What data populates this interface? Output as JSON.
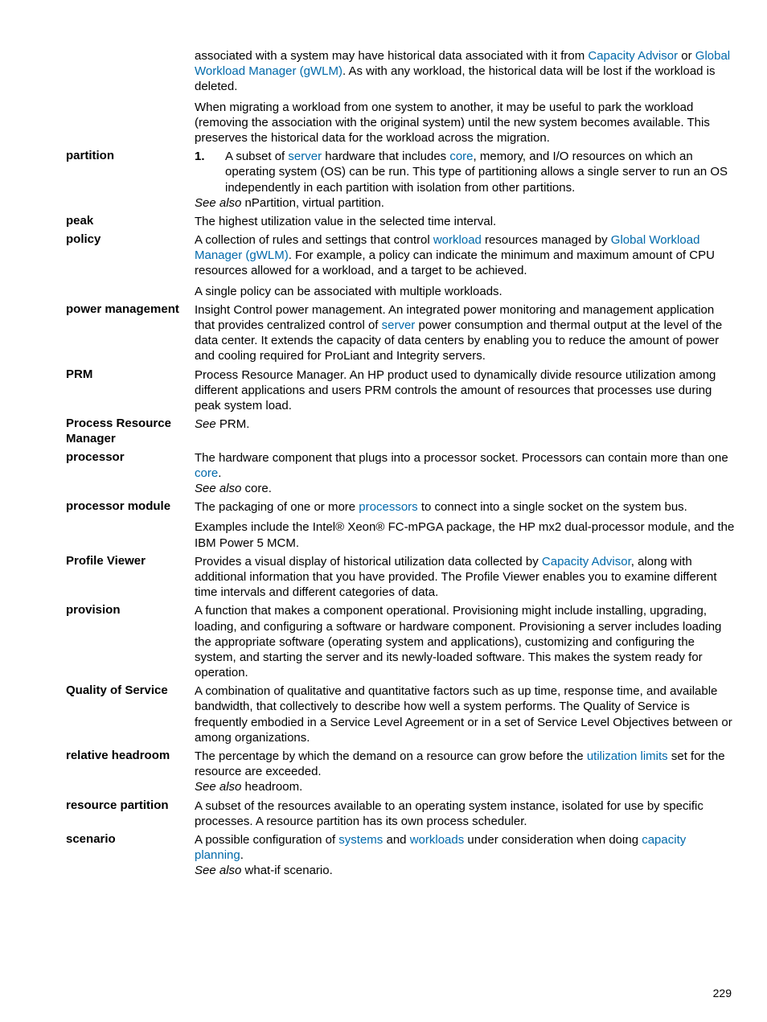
{
  "intro": {
    "p1_a": "associated with a system may have historical data associated with it from ",
    "p1_link1": "Capacity Advisor",
    "p1_b": " or ",
    "p1_link2": "Global Workload Manager (gWLM)",
    "p1_c": ". As with any workload, the historical data will be lost if the workload is deleted.",
    "p2": "When migrating a workload from one system to another, it may be useful to park the workload (removing the association with the original system) until the new system becomes available. This preserves the historical data for the workload across the migration."
  },
  "partition": {
    "term": "partition",
    "num": "1.",
    "d1_a": "A subset of ",
    "d1_link1": "server",
    "d1_b": " hardware that includes ",
    "d1_link2": "core",
    "d1_c": ", memory, and I/O resources on which an operating system (OS) can be run. This type of partitioning allows a single server to run an OS independently in each partition with isolation from other partitions.",
    "see": "See also",
    "see_text": " nPartition, virtual partition."
  },
  "peak": {
    "term": "peak",
    "d": "The highest utilization value in the selected time interval."
  },
  "policy": {
    "term": "policy",
    "d1_a": "A collection of rules and settings that control ",
    "d1_link1": "workload",
    "d1_b": " resources managed by ",
    "d1_link2": "Global Workload Manager (gWLM)",
    "d1_c": ". For example, a policy can indicate the minimum and maximum amount of CPU resources allowed for a workload, and a target to be achieved.",
    "d2": "A single policy can be associated with multiple workloads."
  },
  "power": {
    "term": "power management",
    "d_a": "Insight Control power management. An integrated power monitoring and management application that provides centralized control of ",
    "d_link": "server",
    "d_b": " power consumption and thermal output at the level of the data center. It extends the capacity of data centers by enabling you to reduce the amount of power and cooling required for ProLiant and Integrity servers."
  },
  "prm": {
    "term": "PRM",
    "d": "Process Resource Manager. An HP product used to dynamically divide resource utilization among different applications and users PRM controls the amount of resources that processes use during peak system load."
  },
  "prmfull": {
    "term": "Process Resource Manager",
    "see": "See",
    "see_text": " PRM."
  },
  "processor": {
    "term": "processor",
    "d_a": "The hardware component that plugs into a processor socket. Processors can contain more than one ",
    "d_link": "core",
    "d_b": ".",
    "see": "See also",
    "see_text": " core."
  },
  "procmod": {
    "term": "processor module",
    "d1_a": "The packaging of one or more ",
    "d1_link": "processors",
    "d1_b": " to connect into a single socket on the system bus.",
    "d2": "Examples include the Intel® Xeon® FC-mPGA package, the HP mx2 dual-processor module, and the IBM Power 5 MCM."
  },
  "profile": {
    "term": "Profile Viewer",
    "d_a": "Provides a visual display of historical utilization data collected by ",
    "d_link": "Capacity Advisor",
    "d_b": ", along with additional information that you have provided. The Profile Viewer enables you to examine different time intervals and different categories of data."
  },
  "provision": {
    "term": "provision",
    "d": "A function that makes a component operational. Provisioning might include installing, upgrading, loading, and configuring a software or hardware component. Provisioning a server includes loading the appropriate software (operating system and applications), customizing and configuring the system, and starting the server and its newly-loaded software. This makes the system ready for operation."
  },
  "qos": {
    "term": "Quality of Service",
    "d": "A combination of qualitative and quantitative factors such as up time, response time, and available bandwidth, that collectively to describe how well a system performs. The Quality of Service is frequently embodied in a Service Level Agreement or in a set of Service Level Objectives between or among organizations."
  },
  "relhead": {
    "term": "relative headroom",
    "d_a": "The percentage by which the demand on a resource can grow before the ",
    "d_link": "utilization limits",
    "d_b": " set for the resource are exceeded.",
    "see": "See also",
    "see_text": " headroom."
  },
  "respart": {
    "term": "resource partition",
    "d": "A subset of the resources available to an operating system instance, isolated for use by specific processes. A resource partition has its own process scheduler."
  },
  "scenario": {
    "term": "scenario",
    "d_a": "A possible configuration of ",
    "d_link1": "systems",
    "d_b": " and ",
    "d_link2": "workloads",
    "d_c": " under consideration when doing ",
    "d_link3": "capacity planning",
    "d_d": ".",
    "see": "See also",
    "see_text": " what-if scenario."
  },
  "pagenum": "229"
}
